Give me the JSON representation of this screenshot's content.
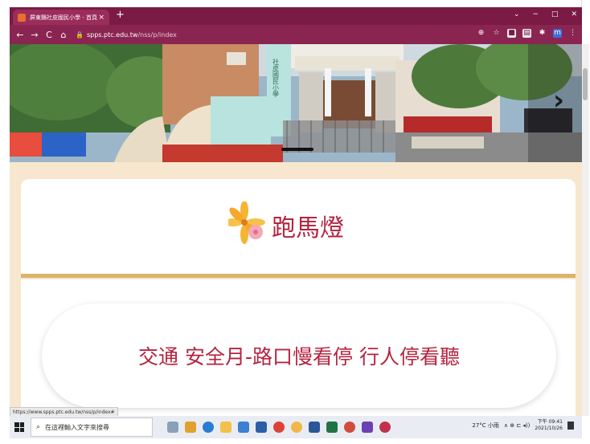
{
  "browser": {
    "tab_title": "屏東縣社皮國民小學 - 首頁",
    "tab_close": "×",
    "new_tab": "+",
    "window_controls": [
      "⌄",
      "−",
      "□",
      "✕"
    ],
    "nav": {
      "back": "←",
      "forward": "→",
      "reload": "C",
      "home": "⌂"
    },
    "lock": "🔒",
    "url_host": "spps.ptc.edu.tw",
    "url_path": "/nss/p/index",
    "extensions": [
      "⊕",
      "☆",
      "■",
      "▤",
      "✱",
      "m",
      "⋮"
    ]
  },
  "page": {
    "banner": {
      "school_vertical_sign": "社皮國民小學",
      "next_arrow": "›"
    },
    "section_title": "跑馬燈",
    "marquee_text": "交通 安全月-路口慢看停 行人停看聽"
  },
  "status_url": "https://www.spps.ptc.edu.tw/nss/p/index#",
  "taskbar": {
    "search_placeholder": "在這裡輸入文字來搜尋",
    "tray_weather": "27°C 小雨",
    "tray_icons": "∧ ⊕ ⊏ ◂))",
    "clock_time": "下午 09:41",
    "clock_date": "2021/10/26"
  },
  "colors": {
    "browser_frame": "#7a1a45",
    "address_bar": "#8a2552",
    "page_bg": "#f7e7cf",
    "accent_red": "#b5233f",
    "divider_gold": "#d9b46a"
  }
}
